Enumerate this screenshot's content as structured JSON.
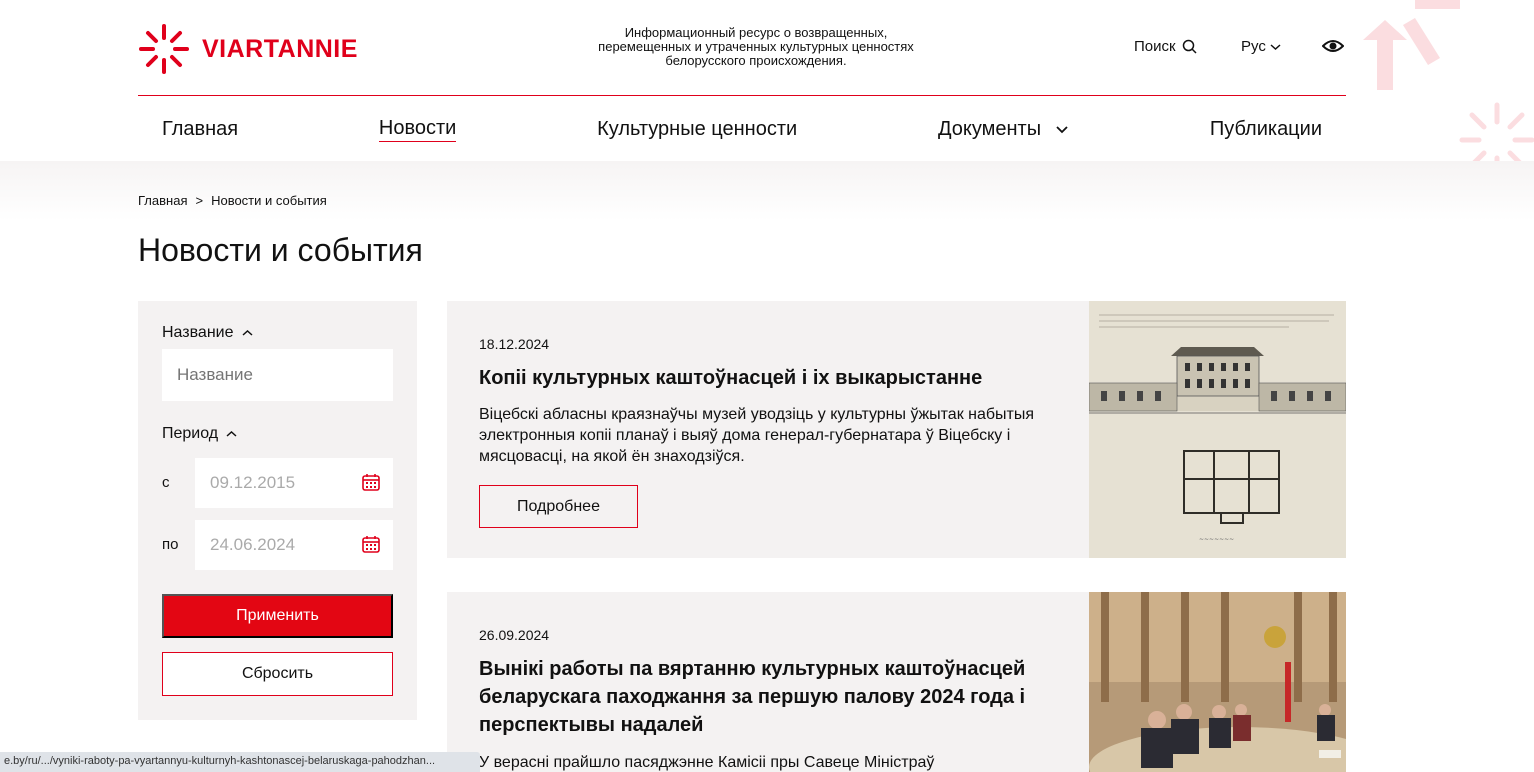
{
  "header": {
    "logo_text": "VIARTANNIE",
    "tagline": "Информационный ресурс о возвращенных, перемещенных и утраченных культурных ценностях белорусского происхождения.",
    "search_label": "Поиск",
    "lang_label": "Рус"
  },
  "nav": {
    "items": [
      {
        "label": "Главная"
      },
      {
        "label": "Новости"
      },
      {
        "label": "Культурные ценности"
      },
      {
        "label": "Документы"
      },
      {
        "label": "Публикации"
      }
    ]
  },
  "breadcrumb": {
    "home": "Главная",
    "separator": ">",
    "current": "Новости и события"
  },
  "page_title": "Новости и события",
  "filter": {
    "name_label": "Название",
    "name_placeholder": "Название",
    "period_label": "Период",
    "from_label": "с",
    "from_value": "09.12.2015",
    "to_label": "по",
    "to_value": "24.06.2024",
    "apply_label": "Применить",
    "reset_label": "Сбросить"
  },
  "news": [
    {
      "date": "18.12.2024",
      "title": "Копіі культурных каштоўнасцей і іх выкарыстанне",
      "text": "Віцебскі абласны краязнаўчы музей уводзіць у культурны ўжытак набытыя электронныя копіі планаў і выяў дома генерал-губернатара ў Віцебску і мясцовасці, на якой ён знаходзіўся.",
      "more_label": "Подробнее"
    },
    {
      "date": "26.09.2024",
      "title": "Вынікі работы па вяртанню культурных каштоўнасцей беларускага паходжання за першую палову 2024 года і перспектывы надалей",
      "text": "У верасні прайшло пасяджэнне Камісіі пры Савеце Міністраў"
    }
  ],
  "status_bar": {
    "url": "e.by/ru/.../vyniki-raboty-pa-vyartannyu-kulturnyh-kashtonascej-belaruskaga-pahodzhan..."
  },
  "colors": {
    "accent": "#e0001b",
    "button": "#e30613",
    "panel": "#f4f2f2"
  }
}
